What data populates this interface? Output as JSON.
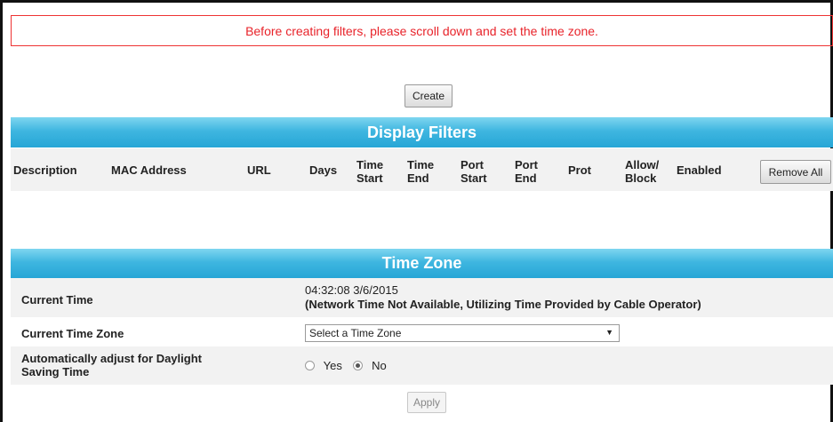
{
  "notice": "Before creating filters, please scroll down and set the time zone.",
  "create_label": "Create",
  "filters": {
    "title": "Display Filters",
    "columns": {
      "description": "Description",
      "mac": "MAC Address",
      "url": "URL",
      "days": "Days",
      "time_start_1": "Time",
      "time_start_2": "Start",
      "time_end_1": "Time",
      "time_end_2": "End",
      "port_start_1": "Port",
      "port_start_2": "Start",
      "port_end_1": "Port",
      "port_end_2": "End",
      "prot": "Prot",
      "allow_1": "Allow/",
      "allow_2": "Block",
      "enabled": "Enabled"
    },
    "remove_all_label": "Remove All"
  },
  "timezone": {
    "title": "Time Zone",
    "current_time_label": "Current Time",
    "current_time_value": "04:32:08 3/6/2015",
    "current_time_note": "(Network Time Not Available, Utilizing Time Provided by Cable Operator)",
    "zone_label": "Current Time Zone",
    "zone_select_value": "Select a Time Zone",
    "dst_label_1": "Automatically adjust for Daylight",
    "dst_label_2": "Saving Time",
    "dst_yes": "Yes",
    "dst_no": "No",
    "dst_selected": "No",
    "apply_label": "Apply"
  }
}
